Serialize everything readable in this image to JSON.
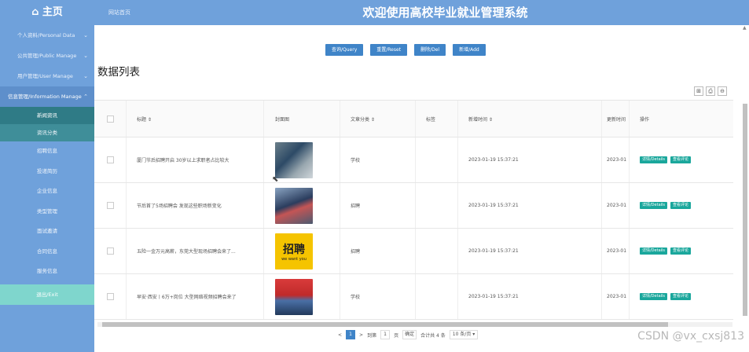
{
  "header": {
    "brand": "⌂ 主页",
    "site_name": "网站首页",
    "system_title": "欢迎使用高校毕业就业管理系统"
  },
  "sidebar": {
    "groups": [
      {
        "label": "个人资料/Personal Data"
      },
      {
        "label": "公共管理/Public Manage"
      },
      {
        "label": "用户管理/User Manage"
      },
      {
        "label": "信息管理/Information Manage"
      }
    ],
    "sub_items": [
      {
        "label": "新闻资讯"
      },
      {
        "label": "资讯分类"
      },
      {
        "label": "招聘信息"
      },
      {
        "label": "投递简历"
      },
      {
        "label": "企业信息"
      },
      {
        "label": "类型管理"
      },
      {
        "label": "面试邀请"
      },
      {
        "label": "合同信息"
      },
      {
        "label": "服务信息"
      }
    ],
    "exit_label": "退出/Exit"
  },
  "actions": {
    "query": "查询/Query",
    "reset": "重置/Reset",
    "delete": "删除/Del",
    "add": "新增/Add"
  },
  "list": {
    "title": "数据列表",
    "tools": [
      "⊞",
      "⎙",
      "⊖"
    ],
    "columns": {
      "title": "标题 ⇕",
      "cover": "封面图",
      "category": "文章分类 ⇕",
      "tags": "标签",
      "created": "新增时间 ⇕",
      "updated": "更新时间",
      "ops": "操作"
    },
    "rows": [
      {
        "title": "厦门节后招聘开启 30岁以上求职者占比较大",
        "category": "学校",
        "created": "2023-01-19 15:37:21",
        "updated": "2023-01"
      },
      {
        "title": "节后首了5场招聘会 发现这些职场新变化",
        "category": "招聘",
        "created": "2023-01-19 15:37:21",
        "updated": "2023-01"
      },
      {
        "title": "五险一金万元高薪，东莞大型现场招聘会来了...",
        "category": "招聘",
        "created": "2023-01-19 15:37:21",
        "updated": "2023-01"
      },
      {
        "title": "早安·西安丨6万+岗位 大型网络视频招聘会来了",
        "category": "学校",
        "created": "2023-01-19 15:37:21",
        "updated": "2023-01"
      }
    ],
    "thumb3": {
      "big": "招聘",
      "small": "we want you"
    },
    "details_label": "详情/Details",
    "comment_label": "查看评论"
  },
  "pager": {
    "prev": "<",
    "current": "1",
    "next": ">",
    "goto_label": "到第",
    "goto_value": "1",
    "page_unit": "页",
    "confirm": "确定",
    "total": "合计共 4 条",
    "page_size": "10 条/页 ▾"
  },
  "watermark": "CSDN @vx_cxsj813"
}
